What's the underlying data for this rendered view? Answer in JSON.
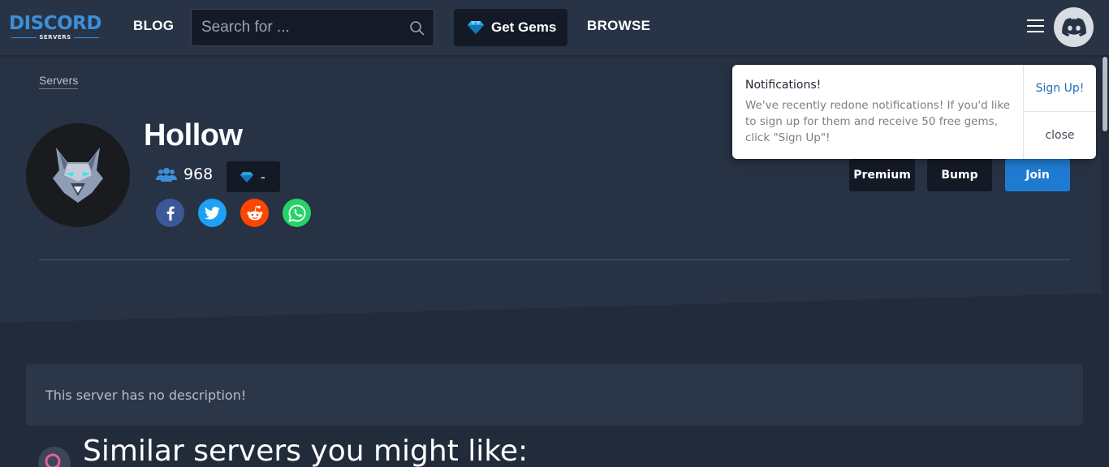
{
  "header": {
    "logo_main": "DISCORD",
    "logo_sub": "SERVERS",
    "blog_label": "BLOG",
    "search_placeholder": "Search for ...",
    "get_gems_label": "Get Gems",
    "browse_label": "BROWSE"
  },
  "breadcrumb": {
    "servers": "Servers"
  },
  "server": {
    "name": "Hollow",
    "member_count": "968",
    "gems": "-",
    "social": [
      "facebook-icon",
      "twitter-icon",
      "reddit-icon",
      "whatsapp-icon"
    ]
  },
  "actions": {
    "premium": "Premium",
    "bump": "Bump",
    "join": "Join"
  },
  "notification": {
    "title": "Notifications!",
    "body": "We've recently redone notifications! If you'd like to sign up for them and receive 50 free gems, click \"Sign Up\"!",
    "signup_label": "Sign Up!",
    "close_label": "close"
  },
  "description": "This server has no description!",
  "similar": {
    "title": "Similar servers you might like:"
  },
  "colors": {
    "accent": "#3d8fd8",
    "join": "#1f7bd1",
    "background": "#222b3a",
    "hero": "#273245",
    "facebook": "#3b5998",
    "twitter": "#1da1f2",
    "reddit": "#ff4500",
    "whatsapp": "#25d366"
  }
}
